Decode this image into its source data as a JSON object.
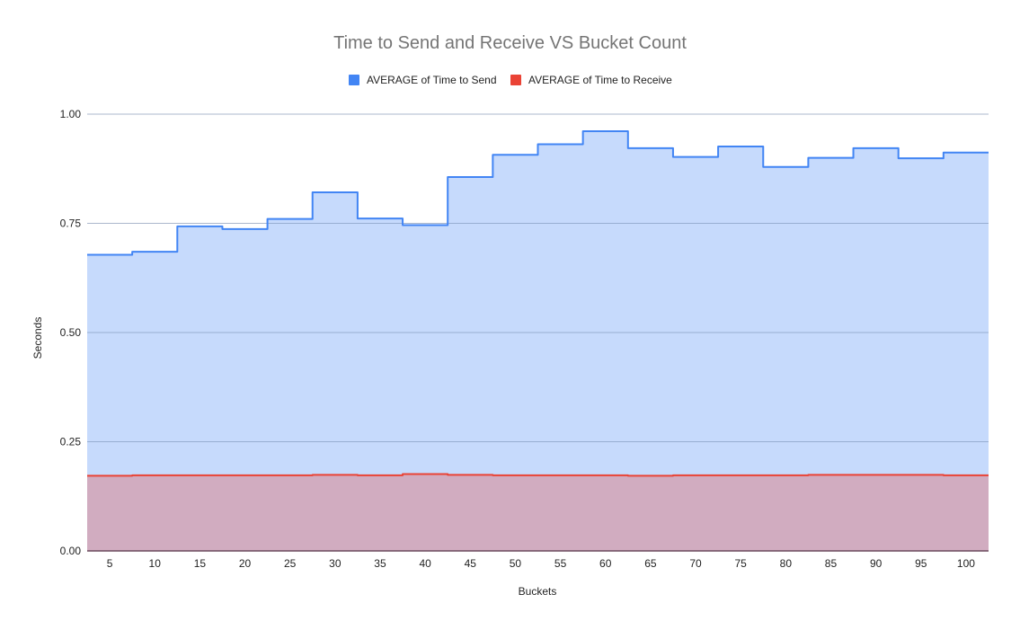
{
  "chart_data": {
    "type": "area",
    "subtype": "stepped",
    "title": "Time to Send and Receive VS Bucket Count",
    "xlabel": "Buckets",
    "ylabel": "Seconds",
    "ylim": [
      0,
      1.0
    ],
    "yticks": [
      "0.00",
      "0.25",
      "0.50",
      "0.75",
      "1.00"
    ],
    "ytick_values": [
      0,
      0.25,
      0.5,
      0.75,
      1.0
    ],
    "grid": true,
    "legend_position": "top",
    "categories": [
      "5",
      "10",
      "15",
      "20",
      "25",
      "30",
      "35",
      "40",
      "45",
      "50",
      "55",
      "60",
      "65",
      "70",
      "75",
      "80",
      "85",
      "90",
      "95",
      "100"
    ],
    "series": [
      {
        "name": "AVERAGE of Time to Send",
        "color": "#4285f4",
        "fill": "#c6daf8",
        "values": [
          0.678,
          0.685,
          0.743,
          0.737,
          0.76,
          0.821,
          0.761,
          0.746,
          0.856,
          0.907,
          0.931,
          0.961,
          0.922,
          0.902,
          0.926,
          0.879,
          0.9,
          0.922,
          0.899,
          0.912
        ]
      },
      {
        "name": "AVERAGE of Time to Receive",
        "color": "#ea4335",
        "fill": "#d2a9bf",
        "values": [
          0.172,
          0.173,
          0.173,
          0.173,
          0.173,
          0.174,
          0.173,
          0.176,
          0.174,
          0.173,
          0.173,
          0.173,
          0.172,
          0.173,
          0.173,
          0.173,
          0.174,
          0.174,
          0.174,
          0.173
        ]
      }
    ]
  }
}
